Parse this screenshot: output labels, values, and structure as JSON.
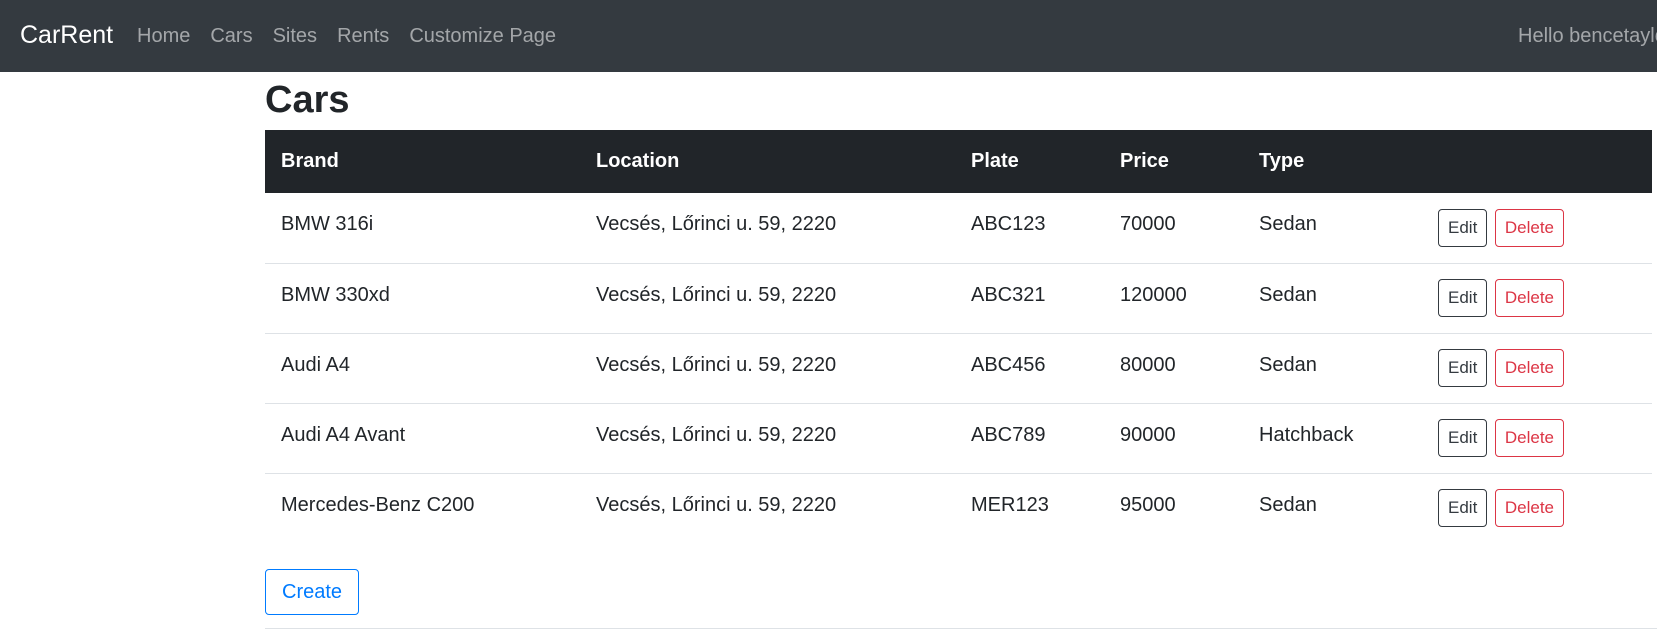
{
  "nav": {
    "brand": "CarRent",
    "links": [
      "Home",
      "Cars",
      "Sites",
      "Rents",
      "Customize Page"
    ],
    "greeting": "Hello bencetaylor"
  },
  "main": {
    "title": "Cars",
    "columns": [
      "Brand",
      "Location",
      "Plate",
      "Price",
      "Type"
    ],
    "rows": [
      {
        "brand": "BMW 316i",
        "location": "Vecsés, Lőrinci u. 59, 2220",
        "plate": "ABC123",
        "price": "70000",
        "type": "Sedan"
      },
      {
        "brand": "BMW 330xd",
        "location": "Vecsés, Lőrinci u. 59, 2220",
        "plate": "ABC321",
        "price": "120000",
        "type": "Sedan"
      },
      {
        "brand": "Audi A4",
        "location": "Vecsés, Lőrinci u. 59, 2220",
        "plate": "ABC456",
        "price": "80000",
        "type": "Sedan"
      },
      {
        "brand": "Audi A4 Avant",
        "location": "Vecsés, Lőrinci u. 59, 2220",
        "plate": "ABC789",
        "price": "90000",
        "type": "Hatchback"
      },
      {
        "brand": "Mercedes-Benz C200",
        "location": "Vecsés, Lőrinci u. 59, 2220",
        "plate": "MER123",
        "price": "95000",
        "type": "Sedan"
      }
    ],
    "edit_label": "Edit",
    "delete_label": "Delete",
    "create_label": "Create"
  },
  "colors": {
    "navbar_bg": "#343a40",
    "table_header_bg": "#212529",
    "primary": "#007bff",
    "danger": "#dc3545"
  }
}
